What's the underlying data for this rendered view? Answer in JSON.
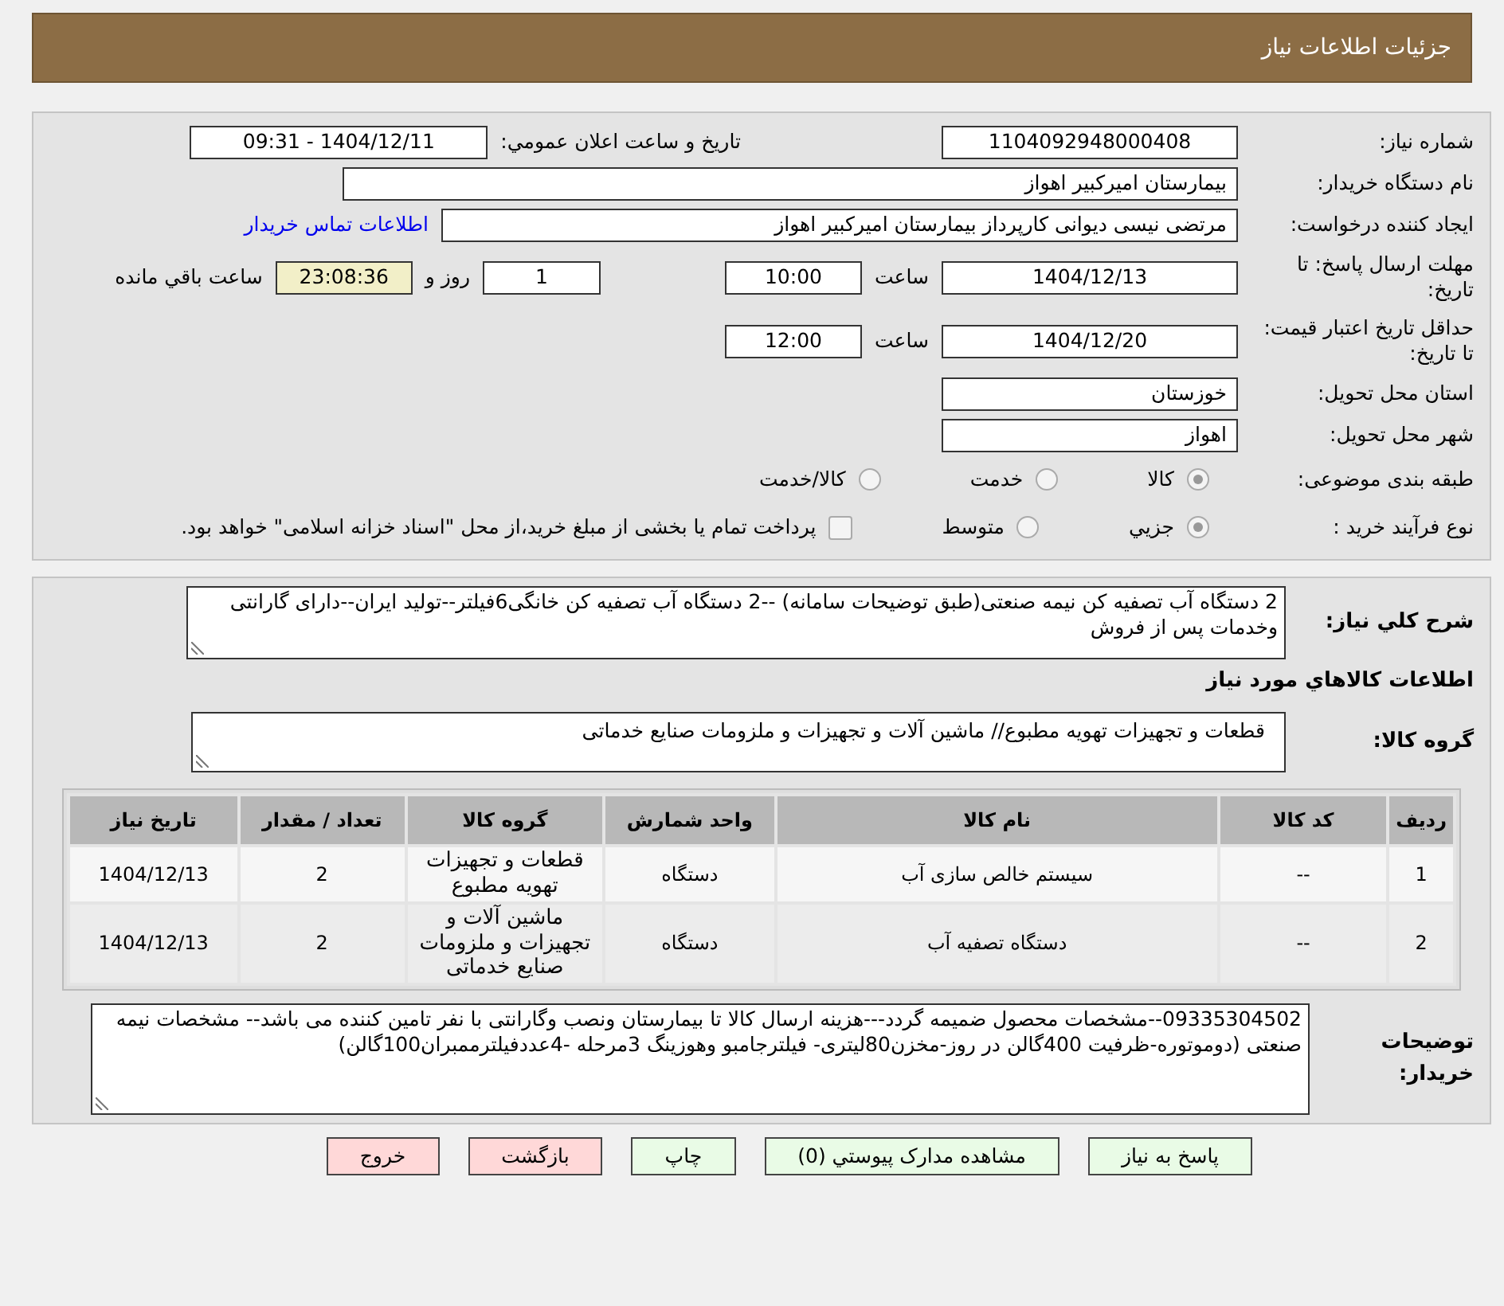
{
  "header": {
    "title": "جزئیات اطلاعات نیاز"
  },
  "info": {
    "need_number": {
      "label": "شماره نیاز:",
      "value": "1104092948000408"
    },
    "announce_datetime": {
      "label": "تاريخ و ساعت اعلان عمومي:",
      "value": "1404/12/11 - 09:31"
    },
    "buyer_org": {
      "label": "نام دستگاه خريدار:",
      "value": "بیمارستان امیرکبیر اهواز"
    },
    "requester": {
      "label": "ایجاد کننده درخواست:",
      "value": "مرتضی نیسی دیوانی کارپرداز بیمارستان امیرکبیر اهواز",
      "contact_link": "اطلاعات تماس خریدار"
    },
    "response_deadline": {
      "label": "مهلت ارسال پاسخ: تا تاریخ:",
      "date": "1404/12/13",
      "time_label": "ساعت",
      "time": "10:00",
      "days": "1",
      "days_label": "روز و",
      "remaining": "23:08:36",
      "remaining_label": "ساعت باقي مانده"
    },
    "price_validity": {
      "label": "حداقل تاریخ اعتبار قیمت: تا تاریخ:",
      "date": "1404/12/20",
      "time_label": "ساعت",
      "time": "12:00"
    },
    "delivery_province": {
      "label": "استان محل تحویل:",
      "value": "خوزستان"
    },
    "delivery_city": {
      "label": "شهر محل تحویل:",
      "value": "اهواز"
    },
    "subject_category": {
      "label": "طبقه بندی موضوعی:",
      "options": [
        {
          "label": "کالا",
          "selected": true
        },
        {
          "label": "خدمت",
          "selected": false
        },
        {
          "label": "کالا/خدمت",
          "selected": false
        }
      ]
    },
    "purchase_process": {
      "label": "نوع فرآیند خرید :",
      "options": [
        {
          "label": "جزيي",
          "selected": true
        },
        {
          "label": "متوسط",
          "selected": false
        }
      ],
      "treasury_option": {
        "label": "پرداخت تمام یا بخشی از مبلغ خرید،از محل \"اسناد خزانه اسلامی\" خواهد بود.",
        "checked": false
      }
    }
  },
  "needs": {
    "description": {
      "label": "شرح کلي نياز:",
      "value": "2 دستگاه آب تصفیه کن نیمه صنعتی(طبق توضیحات سامانه) --2 دستگاه آب تصفیه کن خانگی6فیلتر--تولید ایران--دارای گارانتی  وخدمات پس از فروش"
    },
    "section_title": "اطلاعات کالاهاي مورد نياز",
    "goods_group": {
      "label": "گروه کالا:",
      "value": "قطعات و تجهیزات تهویه مطبوع// ماشین آلات و تجهیزات و ملزومات صنایع خدماتی"
    },
    "table": {
      "columns": [
        "ردیف",
        "کد کالا",
        "نام کالا",
        "واحد شمارش",
        "گروه کالا",
        "تعداد / مقدار",
        "تاریخ نیاز"
      ],
      "rows": [
        [
          "1",
          "--",
          "سیستم خالص سازی آب",
          "دستگاه",
          "قطعات و تجهیزات تهویه مطبوع",
          "2",
          "1404/12/13"
        ],
        [
          "2",
          "--",
          "دستگاه تصفیه آب",
          "دستگاه",
          "ماشین آلات و تجهیزات و ملزومات صنایع خدماتی",
          "2",
          "1404/12/13"
        ]
      ]
    },
    "buyer_notes": {
      "label": "توضیحات خریدار:",
      "value": "09335304502--مشخصات محصول  ضمیمه گردد---هزینه ارسال کالا تا بیمارستان ونصب وگارانتی با نفر تامین کننده می باشد-- مشخصات نیمه صنعتی (دوموتوره-ظرفیت 400گالن در روز-مخزن80لیتری- فیلترجامبو وهوزینگ 3مرحله -4عددفیلترممبران100گالن)"
    }
  },
  "buttons": [
    {
      "label": "پاسخ به نیاز",
      "kind": "action"
    },
    {
      "label": "مشاهده مدارک پیوستي (0)",
      "kind": "action"
    },
    {
      "label": "چاپ",
      "kind": "action"
    },
    {
      "label": "بازگشت",
      "kind": "exit"
    },
    {
      "label": "خروج",
      "kind": "exit"
    }
  ]
}
